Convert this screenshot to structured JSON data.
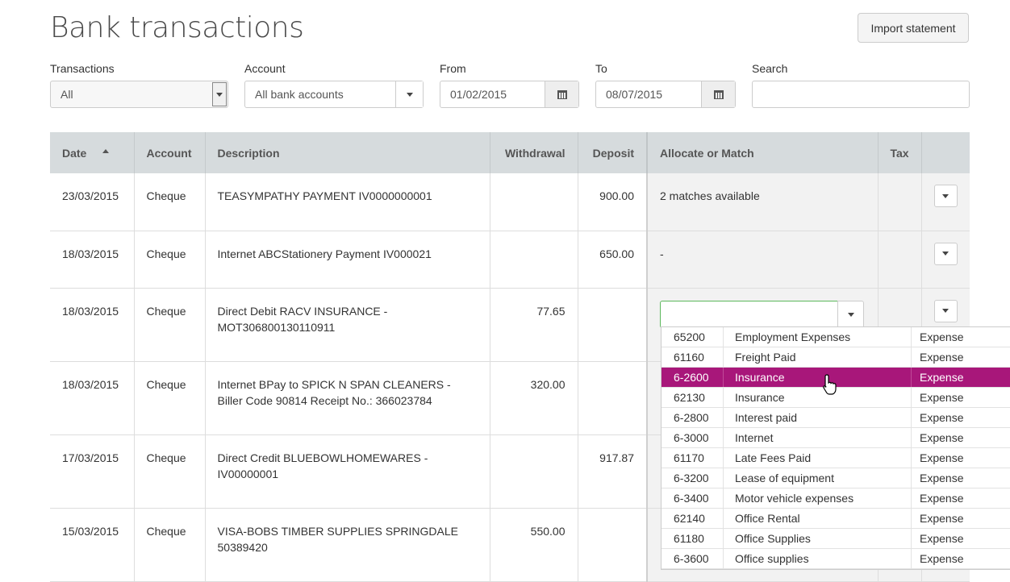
{
  "header": {
    "title": "Bank transactions",
    "import_label": "Import statement"
  },
  "filters": {
    "transactions": {
      "label": "Transactions",
      "value": "All"
    },
    "account": {
      "label": "Account",
      "value": "All bank accounts"
    },
    "from": {
      "label": "From",
      "value": "01/02/2015"
    },
    "to": {
      "label": "To",
      "value": "08/07/2015"
    },
    "search": {
      "label": "Search",
      "value": ""
    }
  },
  "table": {
    "columns": [
      "Date",
      "Account",
      "Description",
      "Withdrawal",
      "Deposit",
      "Allocate or Match",
      "Tax"
    ],
    "rows": [
      {
        "date": "23/03/2015",
        "account": "Cheque",
        "description": "TEASYMPATHY PAYMENT IV0000000001",
        "withdrawal": "",
        "deposit": "900.00",
        "allocate": "2 matches available"
      },
      {
        "date": "18/03/2015",
        "account": "Cheque",
        "description": "Internet ABCStationery Payment IV000021",
        "withdrawal": "",
        "deposit": "650.00",
        "allocate": "-"
      },
      {
        "date": "18/03/2015",
        "account": "Cheque",
        "description": "Direct Debit RACV INSURANCE - MOT306800130110911",
        "withdrawal": "77.65",
        "deposit": "",
        "allocate": ""
      },
      {
        "date": "18/03/2015",
        "account": "Cheque",
        "description": "Internet BPay to SPICK N SPAN CLEANERS - Biller Code 90814 Receipt No.: 366023784",
        "withdrawal": "320.00",
        "deposit": "",
        "allocate": ""
      },
      {
        "date": "17/03/2015",
        "account": "Cheque",
        "description": "Direct Credit BLUEBOWLHOMEWARES - IV00000001",
        "withdrawal": "",
        "deposit": "917.87",
        "allocate": ""
      },
      {
        "date": "15/03/2015",
        "account": "Cheque",
        "description": "VISA-BOBS TIMBER SUPPLIES SPRINGDALE 50389420",
        "withdrawal": "550.00",
        "deposit": "",
        "allocate": ""
      }
    ]
  },
  "allocate_dropdown": {
    "input_value": "",
    "selected_index": 2,
    "options": [
      {
        "code": "65200",
        "name": "Employment Expenses",
        "type": "Expense"
      },
      {
        "code": "61160",
        "name": "Freight Paid",
        "type": "Expense"
      },
      {
        "code": "6-2600",
        "name": "Insurance",
        "type": "Expense"
      },
      {
        "code": "62130",
        "name": "Insurance",
        "type": "Expense"
      },
      {
        "code": "6-2800",
        "name": "Interest paid",
        "type": "Expense"
      },
      {
        "code": "6-3000",
        "name": "Internet",
        "type": "Expense"
      },
      {
        "code": "61170",
        "name": "Late Fees Paid",
        "type": "Expense"
      },
      {
        "code": "6-3200",
        "name": "Lease of equipment",
        "type": "Expense"
      },
      {
        "code": "6-3400",
        "name": "Motor vehicle expenses",
        "type": "Expense"
      },
      {
        "code": "62140",
        "name": "Office Rental",
        "type": "Expense"
      },
      {
        "code": "61180",
        "name": "Office Supplies",
        "type": "Expense"
      },
      {
        "code": "6-3600",
        "name": "Office supplies",
        "type": "Expense"
      }
    ]
  },
  "colors": {
    "selected": "#a8177a",
    "header_bg": "#d6dbdd",
    "valid_border": "#5cb85c"
  }
}
